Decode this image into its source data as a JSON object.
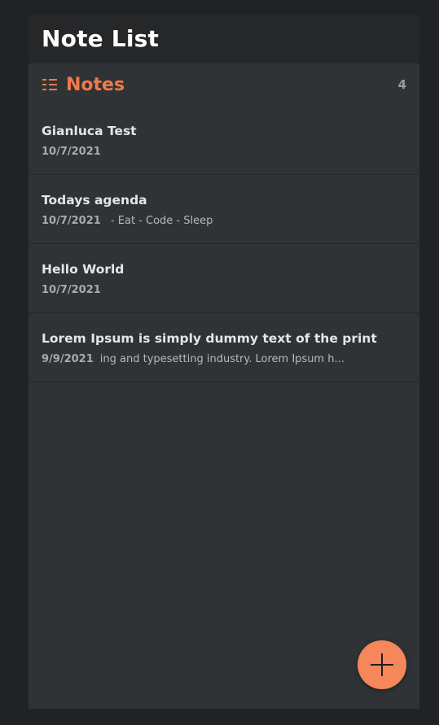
{
  "header": {
    "title": "Note List"
  },
  "section": {
    "icon": "list-icon",
    "title": "Notes",
    "count": "4"
  },
  "notes": [
    {
      "title": "Gianluca Test",
      "date": "10/7/2021",
      "preview": ""
    },
    {
      "title": "Todays agenda",
      "date": "10/7/2021",
      "preview": " - Eat - Code - Sleep"
    },
    {
      "title": "Hello World",
      "date": "10/7/2021",
      "preview": ""
    },
    {
      "title": "Lorem Ipsum is simply dummy text of the print",
      "date": "9/9/2021",
      "preview": "ing and typesetting industry. Lorem Ipsum h..."
    }
  ],
  "fab": {
    "icon": "plus-icon"
  },
  "colors": {
    "background": "#202225",
    "panel": "#2f3336",
    "header": "#262729",
    "accent": "#f07a4a",
    "fab": "#f5875a"
  }
}
